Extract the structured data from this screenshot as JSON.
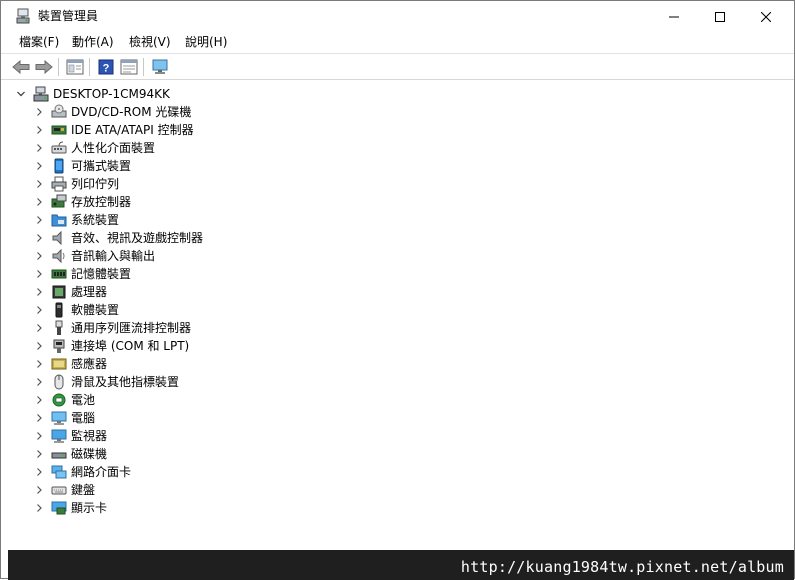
{
  "window": {
    "title": "裝置管理員",
    "icon": "device-manager-icon"
  },
  "menubar": [
    {
      "label": "檔案(F)"
    },
    {
      "label": "動作(A)"
    },
    {
      "label": "檢視(V)"
    },
    {
      "label": "說明(H)"
    }
  ],
  "toolbar": [
    {
      "icon": "back-arrow-icon"
    },
    {
      "icon": "forward-arrow-icon"
    },
    {
      "icon": "properties-icon"
    },
    {
      "icon": "help-icon"
    },
    {
      "icon": "properties-panel-icon"
    },
    {
      "icon": "monitor-scan-icon"
    }
  ],
  "tree": {
    "root": {
      "label": "DESKTOP-1CM94KK",
      "expanded": true,
      "icon": "computer-icon"
    },
    "categories": [
      {
        "label": "DVD/CD-ROM 光碟機",
        "icon": "dvd-drive-icon"
      },
      {
        "label": "IDE ATA/ATAPI 控制器",
        "icon": "ide-controller-icon"
      },
      {
        "label": "人性化介面裝置",
        "icon": "hid-icon"
      },
      {
        "label": "可攜式裝置",
        "icon": "portable-device-icon"
      },
      {
        "label": "列印佇列",
        "icon": "printer-icon"
      },
      {
        "label": "存放控制器",
        "icon": "storage-controller-icon"
      },
      {
        "label": "系統裝置",
        "icon": "system-folder-icon"
      },
      {
        "label": "音效、視訊及遊戲控制器",
        "icon": "speaker-icon"
      },
      {
        "label": "音訊輸入與輸出",
        "icon": "audio-io-icon"
      },
      {
        "label": "記憶體裝置",
        "icon": "memory-icon"
      },
      {
        "label": "處理器",
        "icon": "processor-icon"
      },
      {
        "label": "軟體裝置",
        "icon": "software-device-icon"
      },
      {
        "label": "通用序列匯流排控制器",
        "icon": "usb-icon"
      },
      {
        "label": "連接埠 (COM 和 LPT)",
        "icon": "port-icon"
      },
      {
        "label": "感應器",
        "icon": "sensor-icon"
      },
      {
        "label": "滑鼠及其他指標裝置",
        "icon": "mouse-icon"
      },
      {
        "label": "電池",
        "icon": "battery-icon"
      },
      {
        "label": "電腦",
        "icon": "computer-monitor-icon"
      },
      {
        "label": "監視器",
        "icon": "monitor-icon"
      },
      {
        "label": "磁碟機",
        "icon": "disk-drive-icon"
      },
      {
        "label": "網路介面卡",
        "icon": "network-adapter-icon"
      },
      {
        "label": "鍵盤",
        "icon": "keyboard-icon"
      },
      {
        "label": "顯示卡",
        "icon": "display-adapter-icon"
      }
    ]
  },
  "watermark": "http://kuang1984tw.pixnet.net/album"
}
